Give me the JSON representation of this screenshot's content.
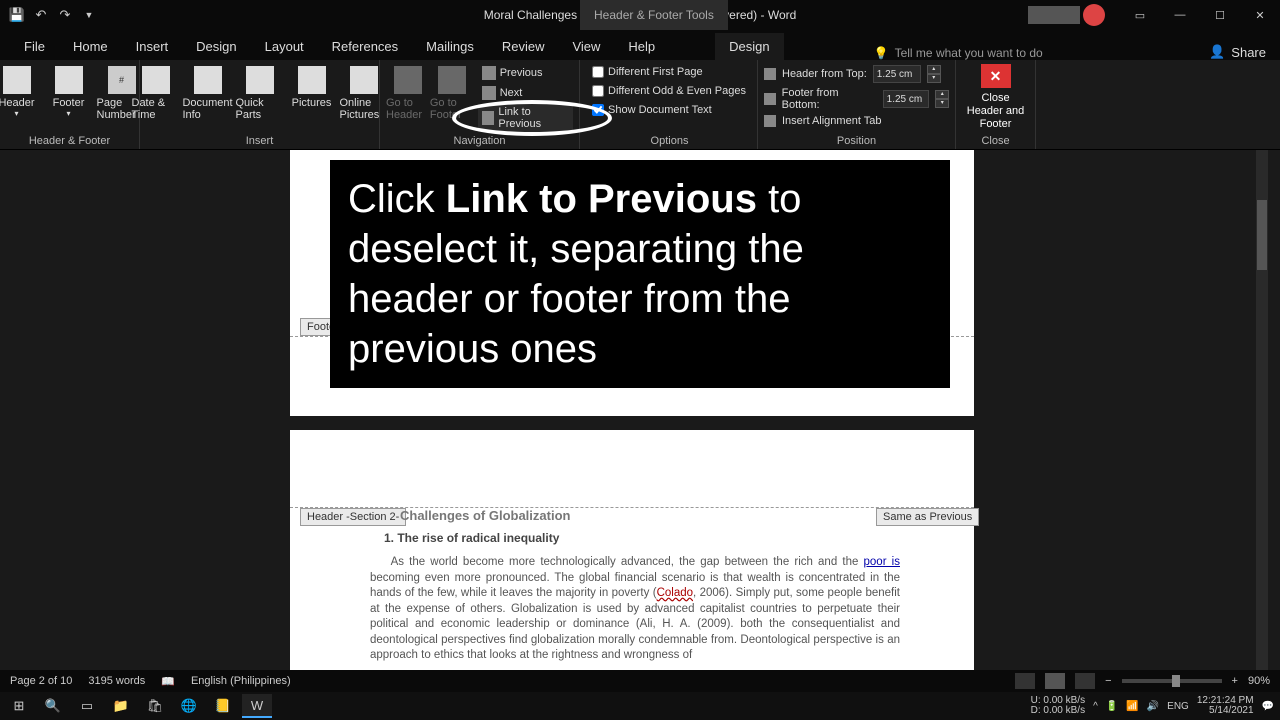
{
  "titlebar": {
    "doc_title": "Moral Challenges of Globalization (AutoRecovered)  -  Word",
    "tool_tab": "Header & Footer Tools"
  },
  "tabs": {
    "file": "File",
    "home": "Home",
    "insert": "Insert",
    "design_main": "Design",
    "layout": "Layout",
    "references": "References",
    "mailings": "Mailings",
    "review": "Review",
    "view": "View",
    "help": "Help",
    "design_hf": "Design",
    "tellme": "Tell me what you want to do",
    "share": "Share"
  },
  "ribbon": {
    "hf_group": "Header & Footer",
    "header": "Header",
    "footer": "Footer",
    "page_number": "Page Number",
    "insert_group": "Insert",
    "date_time": "Date & Time",
    "doc_info": "Document Info",
    "quick_parts": "Quick Parts",
    "pictures": "Pictures",
    "online_pictures": "Online Pictures",
    "nav_group": "Navigation",
    "goto_header": "Go to Header",
    "goto_footer": "Go to Footer",
    "previous": "Previous",
    "next": "Next",
    "link_previous": "Link to Previous",
    "options_group": "Options",
    "diff_first": "Different First Page",
    "diff_odd_even": "Different Odd & Even Pages",
    "show_doc_text": "Show Document Text",
    "position_group": "Position",
    "header_from_top": "Header from Top:",
    "footer_from_bottom": "Footer from Bottom:",
    "header_val": "1.25 cm",
    "footer_val": "1.25 cm",
    "insert_align": "Insert Alignment Tab",
    "close_group": "Close",
    "close_hf": "Close Header and Footer"
  },
  "overlay": {
    "pre": "Click ",
    "bold": "Link to Previous",
    "post": " to deselect it, separating the header or footer from the previous ones"
  },
  "page": {
    "footer_label": "Footer",
    "header_label": "Header -Section 2-",
    "same_prev": "Same as Previous",
    "title": "Challenges of Globalization",
    "sub": "1. The rise of radical inequality",
    "body_1": "As the world become more technologically advanced, the gap between the rich and the ",
    "body_poor": "poor is",
    "body_2": " becoming even more pronounced. The global financial scenario is that wealth is concentrated in the hands of the few, while it leaves the majority in poverty (",
    "body_colado": "Colado",
    "body_3": ", 2006). Simply put, some people benefit at the expense of others. Globalization is used by advanced capitalist countries to perpetuate their political and economic leadership or dominance (Ali, H. A. (2009). both the consequentialist and deontological perspectives find globalization morally condemnable from. Deontological perspective is an approach to ethics that looks at the rightness and wrongness of"
  },
  "status": {
    "page": "Page 2 of 10",
    "words": "3195 words",
    "lang": "English (Philippines)",
    "zoom": "90%"
  },
  "tray": {
    "u": "U:",
    "d": "D:",
    "u_val": "0.00 kB/s",
    "d_val": "0.00 kB/s",
    "lang": "ENG",
    "time": "12:21:24 PM",
    "date": "5/14/2021"
  }
}
